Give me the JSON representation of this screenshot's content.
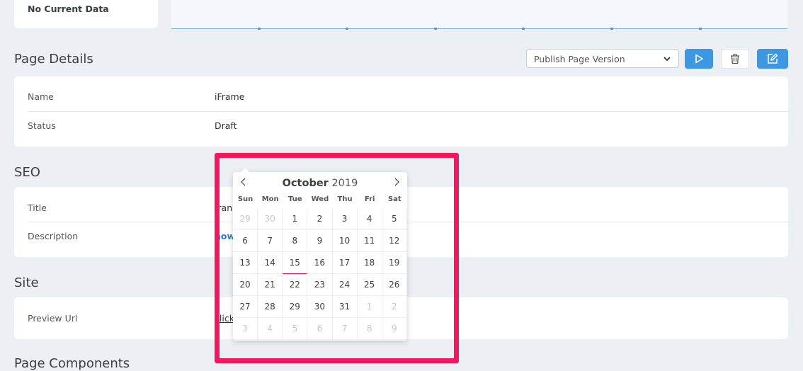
{
  "top_card": {
    "status": "No Current Data"
  },
  "page_details": {
    "title": "Page Details",
    "select": {
      "value": "Publish Page Version"
    },
    "rows": [
      {
        "label": "Name",
        "value": "iFrame"
      },
      {
        "label": "Status",
        "value": "Draft"
      }
    ]
  },
  "seo": {
    "title": "SEO",
    "rows": [
      {
        "label": "Title",
        "value": "fran"
      },
      {
        "label": "Description",
        "value": "how"
      }
    ]
  },
  "site": {
    "title": "Site",
    "rows": [
      {
        "label": "Preview Url",
        "value": "click"
      }
    ]
  },
  "page_components": {
    "title": "Page Components"
  },
  "calendar": {
    "month": "October",
    "year": "2019",
    "weekdays": [
      "Sun",
      "Mon",
      "Tue",
      "Wed",
      "Thu",
      "Fri",
      "Sat"
    ],
    "days": [
      {
        "d": "29",
        "m": true
      },
      {
        "d": "30",
        "m": true
      },
      {
        "d": "1"
      },
      {
        "d": "2"
      },
      {
        "d": "3"
      },
      {
        "d": "4"
      },
      {
        "d": "5"
      },
      {
        "d": "6"
      },
      {
        "d": "7"
      },
      {
        "d": "8"
      },
      {
        "d": "9"
      },
      {
        "d": "10"
      },
      {
        "d": "11"
      },
      {
        "d": "12"
      },
      {
        "d": "13"
      },
      {
        "d": "14"
      },
      {
        "d": "15",
        "t": true
      },
      {
        "d": "16"
      },
      {
        "d": "17"
      },
      {
        "d": "18"
      },
      {
        "d": "19"
      },
      {
        "d": "20"
      },
      {
        "d": "21"
      },
      {
        "d": "22"
      },
      {
        "d": "23"
      },
      {
        "d": "24"
      },
      {
        "d": "25"
      },
      {
        "d": "26"
      },
      {
        "d": "27"
      },
      {
        "d": "28"
      },
      {
        "d": "29"
      },
      {
        "d": "30"
      },
      {
        "d": "31"
      },
      {
        "d": "1",
        "m": true
      },
      {
        "d": "2",
        "m": true
      },
      {
        "d": "3",
        "m": true
      },
      {
        "d": "4",
        "m": true
      },
      {
        "d": "5",
        "m": true
      },
      {
        "d": "6",
        "m": true
      },
      {
        "d": "7",
        "m": true
      },
      {
        "d": "8",
        "m": true
      },
      {
        "d": "9",
        "m": true
      }
    ]
  },
  "icons": {
    "chevron": "chevron-down-icon",
    "play": "play-icon",
    "trash": "trash-icon",
    "edit": "edit-icon",
    "prev": "chevron-left-icon",
    "next": "chevron-right-icon"
  },
  "colors": {
    "accent": "#3d97e3",
    "highlight": "#f4175f",
    "background": "#eceff3"
  }
}
